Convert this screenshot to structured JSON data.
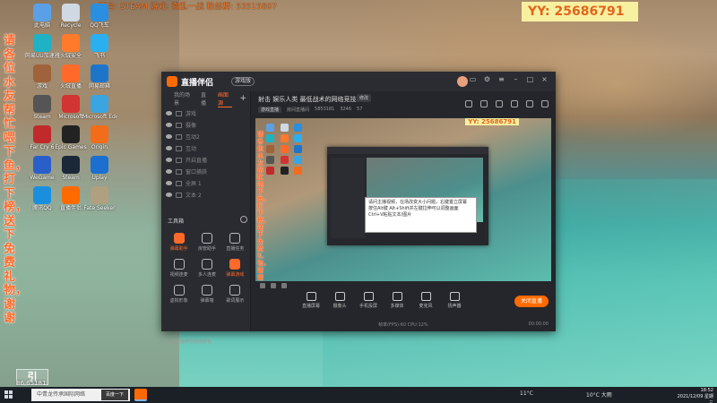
{
  "top_scroll_text": "平台: STEAM  游戏: 微乱一战  粉丝群: 53515807",
  "yy_id": "YY: 25686791",
  "side_marquee": "请各位水友帮忙喂下鱼，打下榜，送下免费礼物，谢谢",
  "desktop_icons": [
    {
      "label": "此电脑",
      "color": "#5aa0e6"
    },
    {
      "label": "Recycle",
      "color": "#cfd8e3"
    },
    {
      "label": "QQ飞车",
      "color": "#2a8fe0"
    },
    {
      "label": "网易UU加速器",
      "color": "#1fb2c5"
    },
    {
      "label": "火绒安全",
      "color": "#ff7a2a"
    },
    {
      "label": "飞书",
      "color": "#2ab0f0"
    },
    {
      "label": "游戏",
      "color": "#a0623a"
    },
    {
      "label": "火绒直播",
      "color": "#ff6a2a"
    },
    {
      "label": "网易邮箱",
      "color": "#1d75c9"
    },
    {
      "label": "Steam",
      "color": "#555"
    },
    {
      "label": "Microsoft",
      "color": "#d23333"
    },
    {
      "label": "Microsoft Edge",
      "color": "#3aa5e0"
    },
    {
      "label": "Far Cry 6",
      "color": "#c02a2a"
    },
    {
      "label": "Epic Games",
      "color": "#222"
    },
    {
      "label": "Origin",
      "color": "#f36c1a"
    },
    {
      "label": "WeGame",
      "color": "#2a5fc9"
    },
    {
      "label": "Steam",
      "color": "#1b2838"
    },
    {
      "label": "Uplay",
      "color": "#1a6fd0"
    },
    {
      "label": "腾讯QQ",
      "color": "#1a8fe0"
    },
    {
      "label": "直播伴侣",
      "color": "#ff6a00"
    },
    {
      "label": "Fate Seeker",
      "color": "#b0a080"
    }
  ],
  "bottom_left_id": "86 65181",
  "app": {
    "name": "直播伴侣",
    "badge": "游戏版",
    "left_tabs": [
      "我的场景",
      "直播",
      "画面源"
    ],
    "scenes": [
      {
        "label": "游戏"
      },
      {
        "label": "摄像"
      },
      {
        "label": "互动2"
      },
      {
        "label": "互动"
      },
      {
        "label": "开启直播"
      },
      {
        "label": "窗口捕获"
      },
      {
        "label": "全屏 1"
      },
      {
        "label": "文本 2"
      }
    ],
    "tools_title": "工具箱",
    "tools": [
      {
        "label": "弹幕助手",
        "hot": true
      },
      {
        "label": "房管助手",
        "hot": false
      },
      {
        "label": "直播任务",
        "hot": false
      },
      {
        "label": "视频连麦",
        "hot": false
      },
      {
        "label": "多人连麦",
        "hot": false
      },
      {
        "label": "弹幕游戏",
        "hot": true
      },
      {
        "label": "虚拟形象",
        "hot": false
      },
      {
        "label": "弹幕墙",
        "hot": false
      },
      {
        "label": "歌词展示",
        "hot": false
      }
    ],
    "footer_text": "火绒直播伴侣使用教程",
    "stream_title": "射击  娱乐人类  最低战术的网络竞技精彩",
    "edit_label": "修改",
    "stream_meta": {
      "tag": "游戏直播",
      "room": "房间直播间",
      "id": "5853181",
      "fans": "3246",
      "online": "57"
    },
    "preview": {
      "yy_id": "YY: 25686791",
      "tooltip_line1": "请问主播视频，在场改变大小问题，右键置立屏幕",
      "tooltip_line2": "按住Alt键 Alt+Shift并左键拉伸可以调整画面",
      "tooltip_line3": "Ctrl+V粘贴文本/图片"
    },
    "actions": [
      "直播屏幕",
      "摄像头",
      "手机投屏",
      "多媒体",
      "麦克风",
      "扬声器"
    ],
    "go_live": "关闭直播",
    "status_info": "帧率(FPS):60 CPU:12%",
    "status_time": "00:00:00"
  },
  "taskbar": {
    "search_placeholder": "中青龙传承国际网络",
    "search_button": "百度一下",
    "weather1": "11°C",
    "weather2": "10°C 大雨",
    "clock_time": "18:52",
    "clock_date": "2021/12/09 星期三"
  }
}
